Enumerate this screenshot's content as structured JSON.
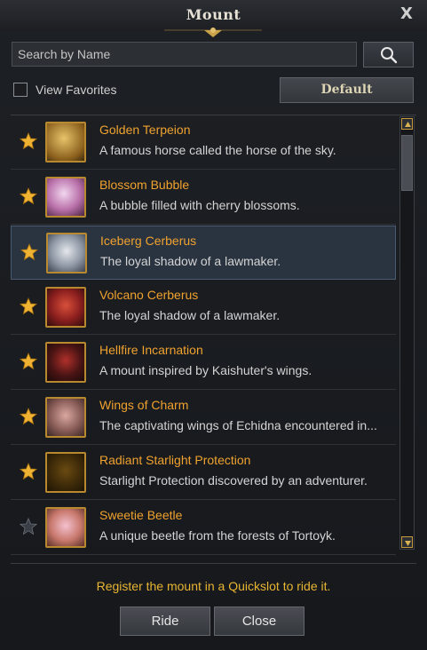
{
  "window": {
    "title": "Mount",
    "close_glyph": "X"
  },
  "search": {
    "placeholder": "Search by Name",
    "value": "",
    "button_icon": "search-icon"
  },
  "filters": {
    "view_favorites_label": "View Favorites",
    "view_favorites_checked": false,
    "default_button_label": "Default"
  },
  "mounts": [
    {
      "name": "Golden Terpeion",
      "description": "A famous horse called the horse of the sky.",
      "favorite": true,
      "icon": "golden-horse",
      "selected": false
    },
    {
      "name": "Blossom Bubble",
      "description": "A bubble filled with cherry blossoms.",
      "favorite": true,
      "icon": "blossom-bubble",
      "selected": false
    },
    {
      "name": "Iceberg Cerberus",
      "description": "The loyal shadow of a lawmaker.",
      "favorite": true,
      "icon": "iceberg-cerberus",
      "selected": true
    },
    {
      "name": "Volcano Cerberus",
      "description": "The loyal shadow of a lawmaker.",
      "favorite": true,
      "icon": "volcano-cerberus",
      "selected": false
    },
    {
      "name": "Hellfire Incarnation",
      "description": "A mount inspired by Kaishuter's wings.",
      "favorite": true,
      "icon": "hellfire-incarnation",
      "selected": false
    },
    {
      "name": "Wings of Charm",
      "description": "The captivating wings of Echidna encountered in...",
      "favorite": true,
      "icon": "wings-of-charm",
      "selected": false
    },
    {
      "name": "Radiant Starlight Protection",
      "description": "Starlight Protection discovered by an adventurer.",
      "favorite": true,
      "icon": "starlight-protection",
      "selected": false
    },
    {
      "name": "Sweetie Beetle",
      "description": "A unique beetle from the forests of Tortoyk.",
      "favorite": false,
      "icon": "sweetie-beetle",
      "selected": false
    }
  ],
  "footer": {
    "hint": "Register the mount in a Quickslot to ride it.",
    "ride_label": "Ride",
    "close_label": "Close"
  },
  "colors": {
    "accent_gold": "#f0a22e",
    "hint_yellow": "#e8b532",
    "selected_row": "#2a3340"
  }
}
